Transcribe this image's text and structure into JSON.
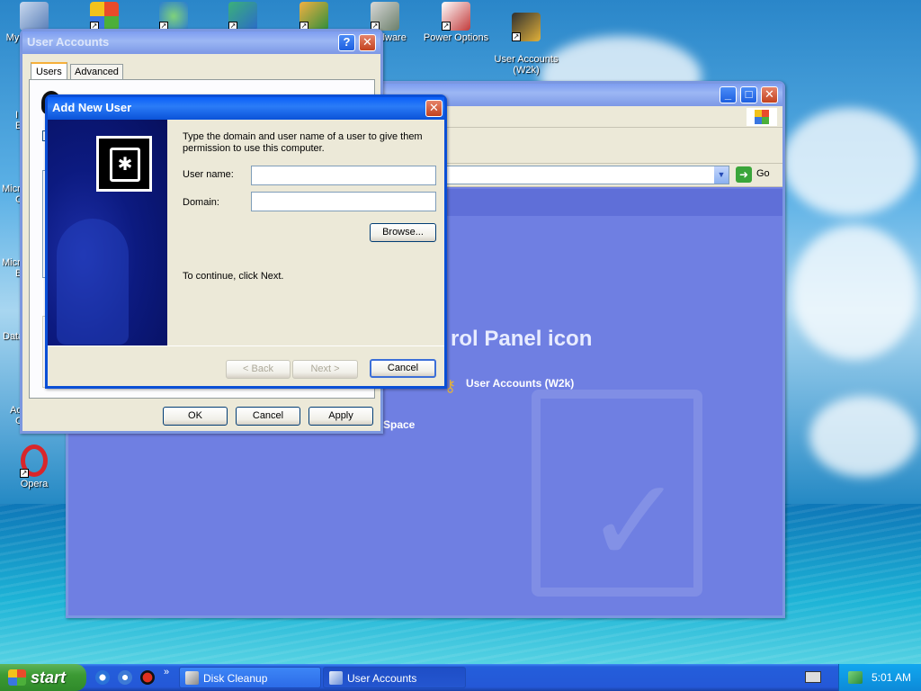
{
  "desktop": {
    "icons": [
      {
        "label": "My"
      },
      {
        "label": "Hardware"
      },
      {
        "label": "Power Options"
      },
      {
        "label": "User Accounts\n(W2k)"
      },
      {
        "label": "Opera"
      }
    ],
    "edge_labels": [
      "I",
      "E",
      "Micro",
      "C",
      "Micro",
      "B",
      "Data",
      "Ac",
      "C"
    ]
  },
  "control_panel": {
    "address_go": "Go",
    "heading": "rol Panel icon",
    "link_user_accounts": "User Accounts (W2k)",
    "link_space": "Space"
  },
  "user_accounts": {
    "title": "User Accounts",
    "tabs": [
      "Users",
      "Advanced"
    ],
    "ok": "OK",
    "cancel": "Cancel",
    "apply": "Apply"
  },
  "add_new_user": {
    "title": "Add New User",
    "instructions": "Type the domain and user name of a user to give them permission to use this computer.",
    "username_label": "User name:",
    "username_value": "",
    "domain_label": "Domain:",
    "domain_value": "",
    "browse": "Browse...",
    "continue_text": "To continue, click Next.",
    "back": "< Back",
    "next": "Next >",
    "cancel": "Cancel"
  },
  "taskbar": {
    "start": "start",
    "items": [
      "Disk Cleanup",
      "User Accounts"
    ],
    "clock": "5:01 AM"
  },
  "colors": {
    "title_blue": "#0a5ff8",
    "dialog_bg": "#ece9d8",
    "control_panel_bg": "#6f7fe2",
    "start_green": "#3c9a34"
  }
}
